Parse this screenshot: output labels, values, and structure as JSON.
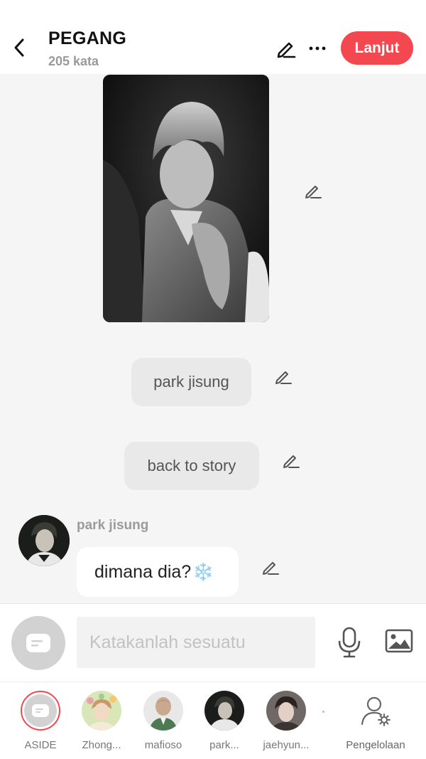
{
  "header": {
    "title": "PEGANG",
    "word_count": "205 kata",
    "continue_label": "Lanjut"
  },
  "story": {
    "photo_alt": "",
    "narration": [
      {
        "text": "park jisung"
      },
      {
        "text": "back to story"
      }
    ],
    "message": {
      "speaker": "park jisung",
      "text": "dimana dia?",
      "emoji": "❄️"
    }
  },
  "composer": {
    "placeholder": "Katakanlah sesuatu"
  },
  "characters": [
    {
      "label": "ASIDE"
    },
    {
      "label": "Zhong..."
    },
    {
      "label": "mafioso"
    },
    {
      "label": "park..."
    },
    {
      "label": "jaehyun..."
    }
  ],
  "management_label": "Pengelolaan",
  "colors": {
    "accent": "#f44850",
    "background": "#f5f5f5",
    "bubble_gray": "#e9e9e9",
    "muted_text": "#9a9a9a"
  }
}
